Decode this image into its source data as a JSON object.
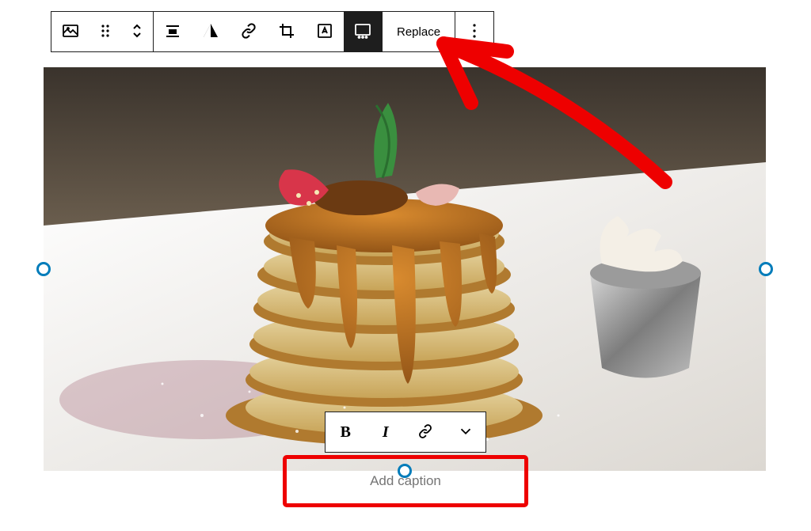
{
  "toolbar": {
    "block_type_icon": "image-icon",
    "drag_icon": "drag-handle-icon",
    "move_icon": "move-updown-icon",
    "align_icon": "align-icon",
    "duotone_icon": "duotone-icon",
    "link_icon": "link-icon",
    "crop_icon": "crop-icon",
    "text_overlay_icon": "text-overlay-icon",
    "caption_toggle_icon": "caption-icon",
    "replace_label": "Replace",
    "more_icon": "more-vertical-icon"
  },
  "image": {
    "alt_description": "Stack of pancakes with caramel syrup, strawberry and mint garnish, side of whipped cream in metal cup, on white plate"
  },
  "caption_toolbar": {
    "bold_label": "B",
    "italic_label": "I",
    "link_icon": "link-icon",
    "more_icon": "chevron-down-icon"
  },
  "caption": {
    "placeholder": "Add caption",
    "value": ""
  },
  "annotation": {
    "color": "#ee0000"
  }
}
